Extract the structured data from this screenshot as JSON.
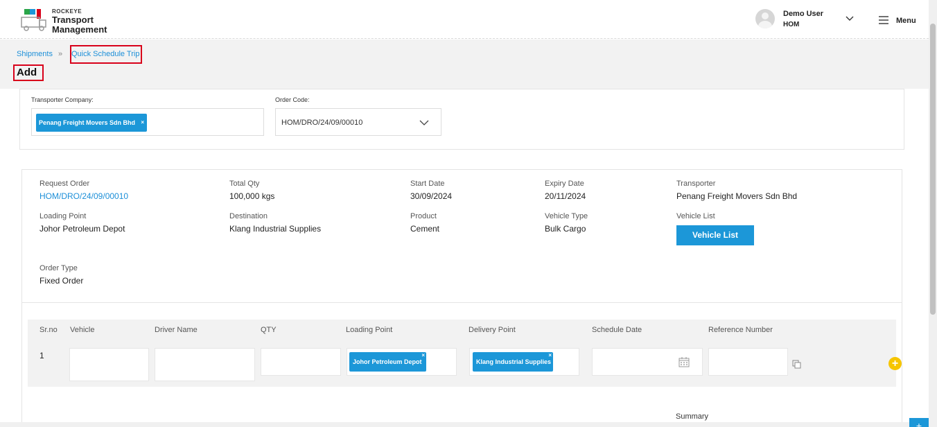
{
  "header": {
    "brand_small": "ROCKEYE",
    "brand_line1": "Transport",
    "brand_line2": "Management",
    "user_name": "Demo User",
    "user_code": "HOM",
    "menu_label": "Menu"
  },
  "breadcrumb": {
    "root": "Shipments",
    "separator": "»",
    "current": "Quick Schedule Trip"
  },
  "page": {
    "title": "Add"
  },
  "filters": {
    "transporter_label": "Transporter Company:",
    "transporter_chip": "Penang Freight Movers Sdn Bhd",
    "order_code_label": "Order Code:",
    "order_code_value": "HOM/DRO/24/09/00010",
    "remove_symbol": "×"
  },
  "details": {
    "request_order_label": "Request Order",
    "request_order_value": "HOM/DRO/24/09/00010",
    "total_qty_label": "Total Qty",
    "total_qty_value": "100,000 kgs",
    "start_date_label": "Start Date",
    "start_date_value": "30/09/2024",
    "expiry_date_label": "Expiry Date",
    "expiry_date_value": "20/11/2024",
    "transporter_label": "Transporter",
    "transporter_value": "Penang Freight Movers Sdn Bhd",
    "loading_point_label": "Loading Point",
    "loading_point_value": "Johor Petroleum Depot",
    "destination_label": "Destination",
    "destination_value": "Klang Industrial Supplies",
    "product_label": "Product",
    "product_value": "Cement",
    "vehicle_type_label": "Vehicle Type",
    "vehicle_type_value": "Bulk Cargo",
    "vehicle_list_label": "Vehicle List",
    "vehicle_list_button": "Vehicle List",
    "order_type_label": "Order Type",
    "order_type_value": "Fixed Order"
  },
  "table": {
    "columns": [
      "Sr.no",
      "Vehicle",
      "Driver Name",
      "QTY",
      "Loading Point",
      "Delivery Point",
      "Schedule Date",
      "Reference Number"
    ],
    "rows": [
      {
        "sr_no": "1",
        "loading_point_chip": "Johor Petroleum Depot",
        "delivery_point_chip": "Klang Industrial Supplies"
      }
    ],
    "add_symbol": "+"
  },
  "summary_label": "Summary",
  "fab_symbol": "+",
  "colors": {
    "accent": "#1c97d8",
    "link": "#1c8fd8",
    "highlight_border": "#d8001a",
    "add_button": "#f6c500"
  }
}
